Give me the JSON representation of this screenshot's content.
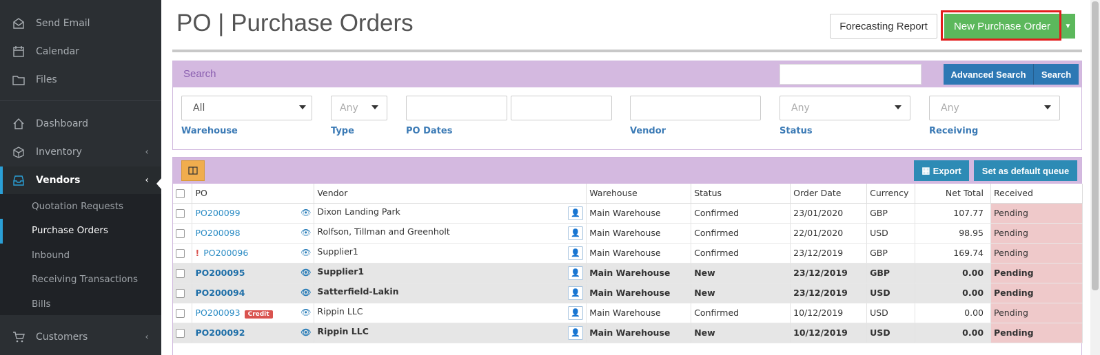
{
  "sidebar": {
    "top_items": [
      {
        "label": "Send Email",
        "icon": "send-email-icon"
      },
      {
        "label": "Calendar",
        "icon": "calendar-icon"
      },
      {
        "label": "Files",
        "icon": "folder-icon"
      }
    ],
    "items": [
      {
        "label": "Dashboard",
        "icon": "home-icon"
      },
      {
        "label": "Inventory",
        "icon": "box-icon"
      },
      {
        "label": "Vendors",
        "icon": "inbox-icon"
      }
    ],
    "vendor_sub": [
      "Quotation Requests",
      "Purchase Orders",
      "Inbound",
      "Receiving Transactions",
      "Bills"
    ],
    "customers": {
      "label": "Customers",
      "icon": "cart-icon"
    }
  },
  "header": {
    "title": "PO | Purchase Orders",
    "forecast_label": "Forecasting Report",
    "new_po_label": "New Purchase Order"
  },
  "search": {
    "title": "Search",
    "advanced_label": "Advanced Search",
    "search_label": "Search",
    "warehouse_value": "All",
    "type_value": "Any",
    "status_value": "Any",
    "receiving_value": "Any",
    "labels": {
      "warehouse": "Warehouse",
      "type": "Type",
      "po_dates": "PO Dates",
      "vendor": "Vendor",
      "status": "Status",
      "receiving": "Receiving"
    }
  },
  "toolbar": {
    "export_label": "Export",
    "default_queue_label": "Set as default queue"
  },
  "table": {
    "columns": [
      "PO",
      "Vendor",
      "Warehouse",
      "Status",
      "Order Date",
      "Currency",
      "Net Total",
      "Received"
    ],
    "rows": [
      {
        "po": "PO200099",
        "vendor": "Dixon Landing Park",
        "warehouse": "Main Warehouse",
        "status": "Confirmed",
        "date": "23/01/2020",
        "currency": "GBP",
        "total": "107.77",
        "received": "Pending",
        "new": false,
        "flag": false,
        "credit": false
      },
      {
        "po": "PO200098",
        "vendor": "Rolfson, Tillman and Greenholt",
        "warehouse": "Main Warehouse",
        "status": "Confirmed",
        "date": "22/01/2020",
        "currency": "USD",
        "total": "98.95",
        "received": "Pending",
        "new": false,
        "flag": false,
        "credit": false
      },
      {
        "po": "PO200096",
        "vendor": "Supplier1",
        "warehouse": "Main Warehouse",
        "status": "Confirmed",
        "date": "23/12/2019",
        "currency": "GBP",
        "total": "169.74",
        "received": "Pending",
        "new": false,
        "flag": true,
        "credit": false
      },
      {
        "po": "PO200095",
        "vendor": "Supplier1",
        "warehouse": "Main Warehouse",
        "status": "New",
        "date": "23/12/2019",
        "currency": "GBP",
        "total": "0.00",
        "received": "Pending",
        "new": true,
        "flag": false,
        "credit": false
      },
      {
        "po": "PO200094",
        "vendor": "Satterfield-Lakin",
        "warehouse": "Main Warehouse",
        "status": "New",
        "date": "23/12/2019",
        "currency": "USD",
        "total": "0.00",
        "received": "Pending",
        "new": true,
        "flag": false,
        "credit": false
      },
      {
        "po": "PO200093",
        "vendor": "Rippin LLC",
        "warehouse": "Main Warehouse",
        "status": "Confirmed",
        "date": "10/12/2019",
        "currency": "USD",
        "total": "0.00",
        "received": "Pending",
        "new": false,
        "flag": false,
        "credit": true
      },
      {
        "po": "PO200092",
        "vendor": "Rippin LLC",
        "warehouse": "Main Warehouse",
        "status": "New",
        "date": "10/12/2019",
        "currency": "USD",
        "total": "0.00",
        "received": "Pending",
        "new": true,
        "flag": false,
        "credit": false
      }
    ],
    "credit_label": "Credit",
    "flag_mark": "!"
  }
}
